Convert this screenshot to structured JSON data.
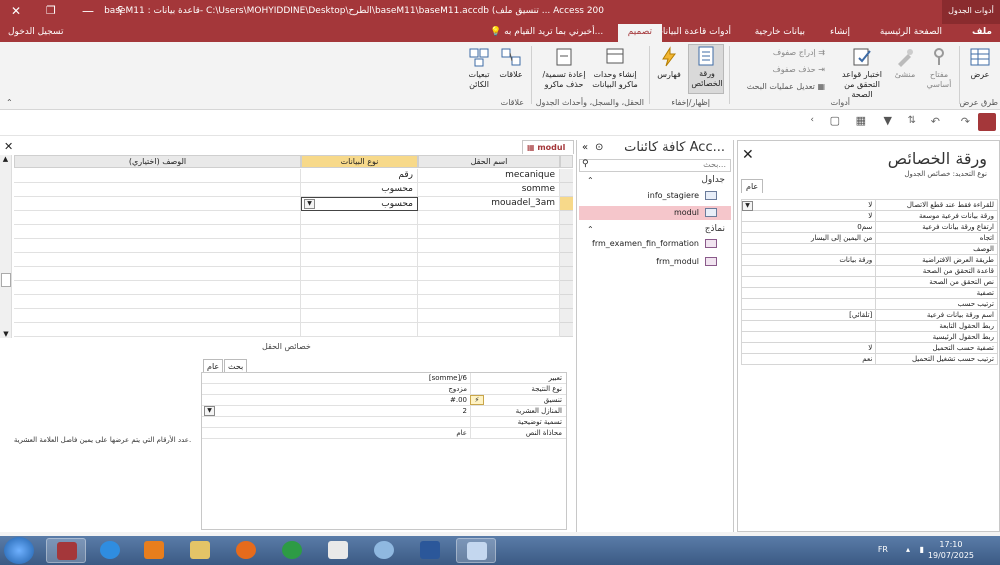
{
  "titlebar": {
    "title": "أدوات الجدول  base M11 : قاعدة بيانات- C:\\Users\\MOHYIDDINE\\Desktop\\الطرح\\baseM11\\baseM11.accdb (تنسيق ملف ... Access 200",
    "file_title": "baseM11 : قاعدة بيانات- C:\\Users\\MOHYIDDINE\\Desktop\\الطرح\\baseM11\\baseM11.accdb (تنسيق ملف ... Access 200",
    "contextual_tab": "أدوات الجدول",
    "help": "؟"
  },
  "tabs": {
    "file": "ملف",
    "home": "الصفحة الرئيسية",
    "create": "إنشاء",
    "external": "بيانات خارجية",
    "dbtools": "أدوات قاعدة البيانات",
    "design": "تصميم",
    "tell_me": "أخبرني بما تريد القيام به...",
    "sign_in": "تسجيل الدخول"
  },
  "ribbon": {
    "view": "عرض",
    "views_group": "طرق عرض",
    "primary_key": "مفتاح أساسي",
    "builder": "منشئ",
    "test_rules": "اختبار قواعد التحقق من الصحة",
    "insert_rows": "إدراج صفوف",
    "delete_rows": "حذف صفوف",
    "modify_lookups": "تعديل عمليات البحث",
    "tools_group": "أدوات",
    "property_sheet": "ورقة الخصائص",
    "indexes": "فهارس",
    "showhide_group": "إظهار/إخفاء",
    "create_macros": "إنشاء وحدات ماكرو البيانات",
    "rename_macro": "إعادة تسمية/حذف ماكرو",
    "field_events_group": "الحقل، والسجل، وأحداث الجدول",
    "relationships": "علاقات",
    "dependencies": "تبعيات الكائن",
    "relationships_group": "علاقات"
  },
  "property_sheet": {
    "title": "ورقة الخصائص",
    "selection_label": "نوع التحديد: خصائص الجدول",
    "tab_all": "عام",
    "rows": [
      {
        "label": "للقراءة فقط عند قطع الاتصال",
        "value": "لا"
      },
      {
        "label": "ورقة بيانات فرعية موسعة",
        "value": "لا"
      },
      {
        "label": "ارتفاع ورقة بيانات فرعية",
        "value": "0سم"
      },
      {
        "label": "اتجاه",
        "value": "من اليمين إلى اليسار"
      },
      {
        "label": "الوصف",
        "value": ""
      },
      {
        "label": "طريقة العرض الافتراضية",
        "value": "ورقة بيانات"
      },
      {
        "label": "قاعدة التحقق من الصحة",
        "value": ""
      },
      {
        "label": "نص التحقق من الصحة",
        "value": ""
      },
      {
        "label": "تصفية",
        "value": ""
      },
      {
        "label": "ترتيب حسب",
        "value": ""
      },
      {
        "label": "اسم ورقة بيانات فرعية",
        "value": "[تلقائي]"
      },
      {
        "label": "ربط الحقول التابعة",
        "value": ""
      },
      {
        "label": "ربط الحقول الرئيسية",
        "value": ""
      },
      {
        "label": "تصفية حسب التحميل",
        "value": "لا"
      },
      {
        "label": "ترتيب حسب تشغيل التحميل",
        "value": "نعم"
      }
    ]
  },
  "nav": {
    "header": "كافة كائنات Acc...",
    "search_placeholder": "بحث...",
    "tables_group": "جداول",
    "forms_group": "نماذج",
    "tables": [
      "info_stagiere",
      "modul"
    ],
    "forms": [
      "frm_examen_fin_formation",
      "frm_modul"
    ]
  },
  "design": {
    "tab_label": "modul",
    "col_field": "اسم الحقل",
    "col_type": "نوع البيانات",
    "col_desc": "الوصف (اختياري)",
    "rows": [
      {
        "field": "mecanique",
        "type": "رقم"
      },
      {
        "field": "somme",
        "type": "محسوب"
      },
      {
        "field": "mouadel_3am",
        "type": "محسوب"
      }
    ],
    "field_props_label": "خصائص الحقل",
    "tab_general": "عام",
    "tab_lookup": "بحث",
    "props": [
      {
        "label": "تعبير",
        "value": "[somme]/6"
      },
      {
        "label": "نوع النتيجة",
        "value": "مزدوج"
      },
      {
        "label": "تنسيق",
        "value": "#.00"
      },
      {
        "label": "المنازل العشرية",
        "value": "2"
      },
      {
        "label": "تسمية توضيحية",
        "value": ""
      },
      {
        "label": "محاذاة النص",
        "value": "عام"
      }
    ],
    "help_text": "عدد الأرقام التي يتم عرضها على يمين فاصل العلامة العشرية."
  },
  "taskbar": {
    "lang": "FR",
    "time": "17:10",
    "date": "19/07/2025"
  },
  "colors": {
    "accent": "#a4373a",
    "selection": "#f5c6cb",
    "active_col": "#f7d98a"
  }
}
